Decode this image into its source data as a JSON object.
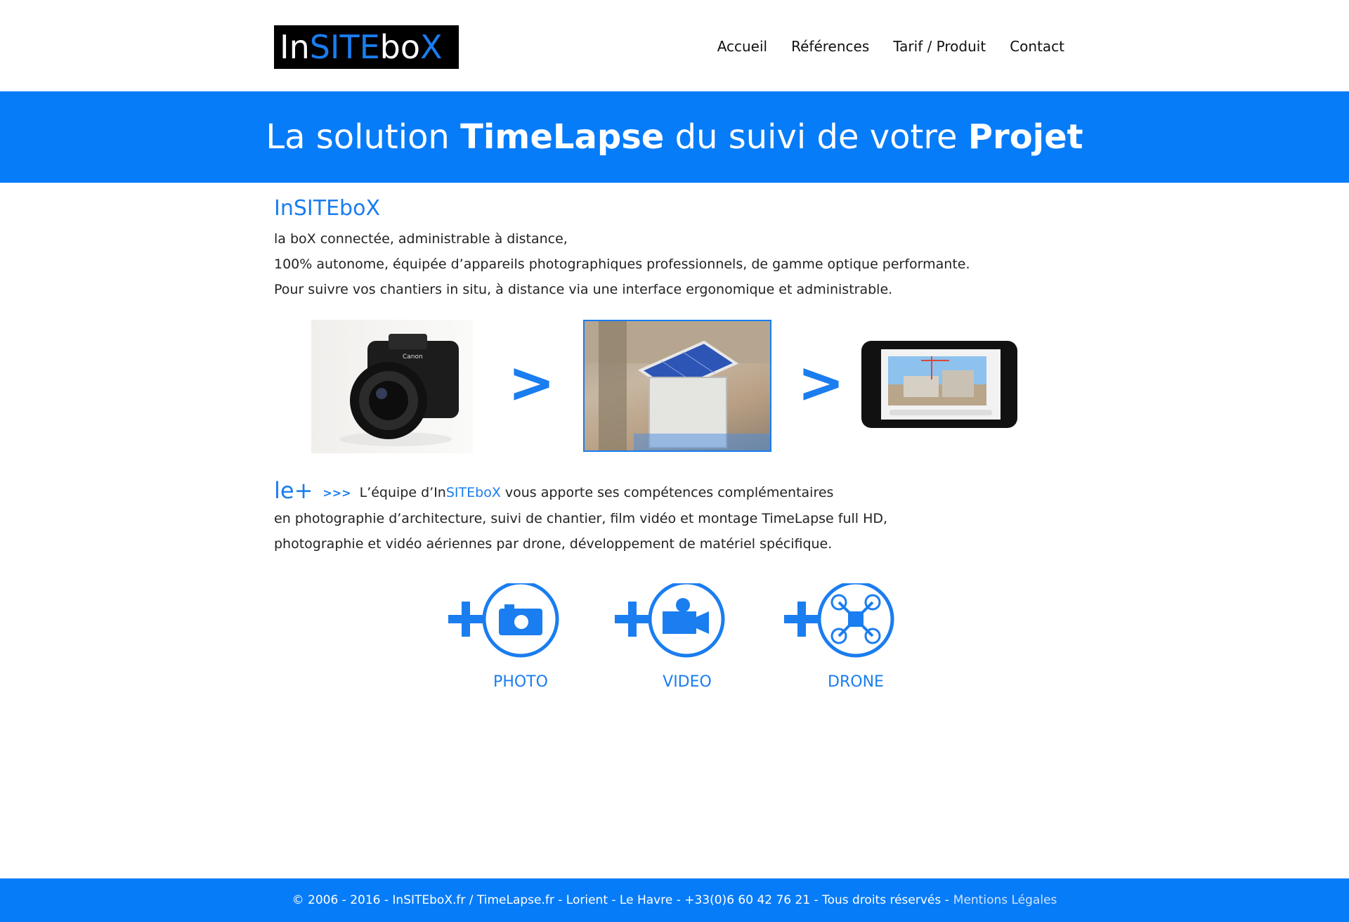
{
  "header": {
    "logo": {
      "part1": "In",
      "part2": "SITE",
      "part3": "bo",
      "part4": "X"
    },
    "nav": [
      "Accueil",
      "Références",
      "Tarif / Produit",
      "Contact"
    ]
  },
  "banner": {
    "text_before": "La solution ",
    "text_bold1": "TimeLapse",
    "text_middle": " du suivi de votre ",
    "text_bold2": "Projet"
  },
  "intro": {
    "title": {
      "part1": "In",
      "part2": "SITE",
      "part3": "bo",
      "part4": "X"
    },
    "lines": [
      "la boX connectée, administrable à  distance,",
      "100% autonome, équipée d’appareils photographiques professionnels, de gamme optique performante.",
      "Pour suivre vos chantiers in situ, à  distance via une interface ergonomique et administrable."
    ]
  },
  "steps": {
    "arrow": ">",
    "icons": [
      "camera-photo",
      "solar-box-photo",
      "smartphone-photo"
    ]
  },
  "leplus": {
    "label": "le+",
    "chevrons": ">>>",
    "line1_before": "L’équipe d’",
    "line1_brand_a": "In",
    "line1_brand_b": "SITE",
    "line1_brand_c": "boX",
    "line1_after": "  vous apporte ses compétences complémentaires",
    "line2": "en photographie d’architecture, suivi de chantier, film vidéo et montage TimeLapse full HD,",
    "line3": "photographie et vidéo aériennes par drone, développement de matériel spécifique."
  },
  "services": [
    {
      "label": "PHOTO",
      "icon": "camera-icon"
    },
    {
      "label": "VIDEO",
      "icon": "video-camera-icon"
    },
    {
      "label": "DRONE",
      "icon": "drone-icon"
    }
  ],
  "footer": {
    "text": "© 2006 - 2016 - InSITEboX.fr / TimeLapse.fr - Lorient - Le Havre - +33(0)6 60 42 76 21 - Tous droits réservés -",
    "link": "Mentions Légales"
  },
  "colors": {
    "brand_blue": "#077cf9",
    "text_blue": "#1a7df0"
  }
}
